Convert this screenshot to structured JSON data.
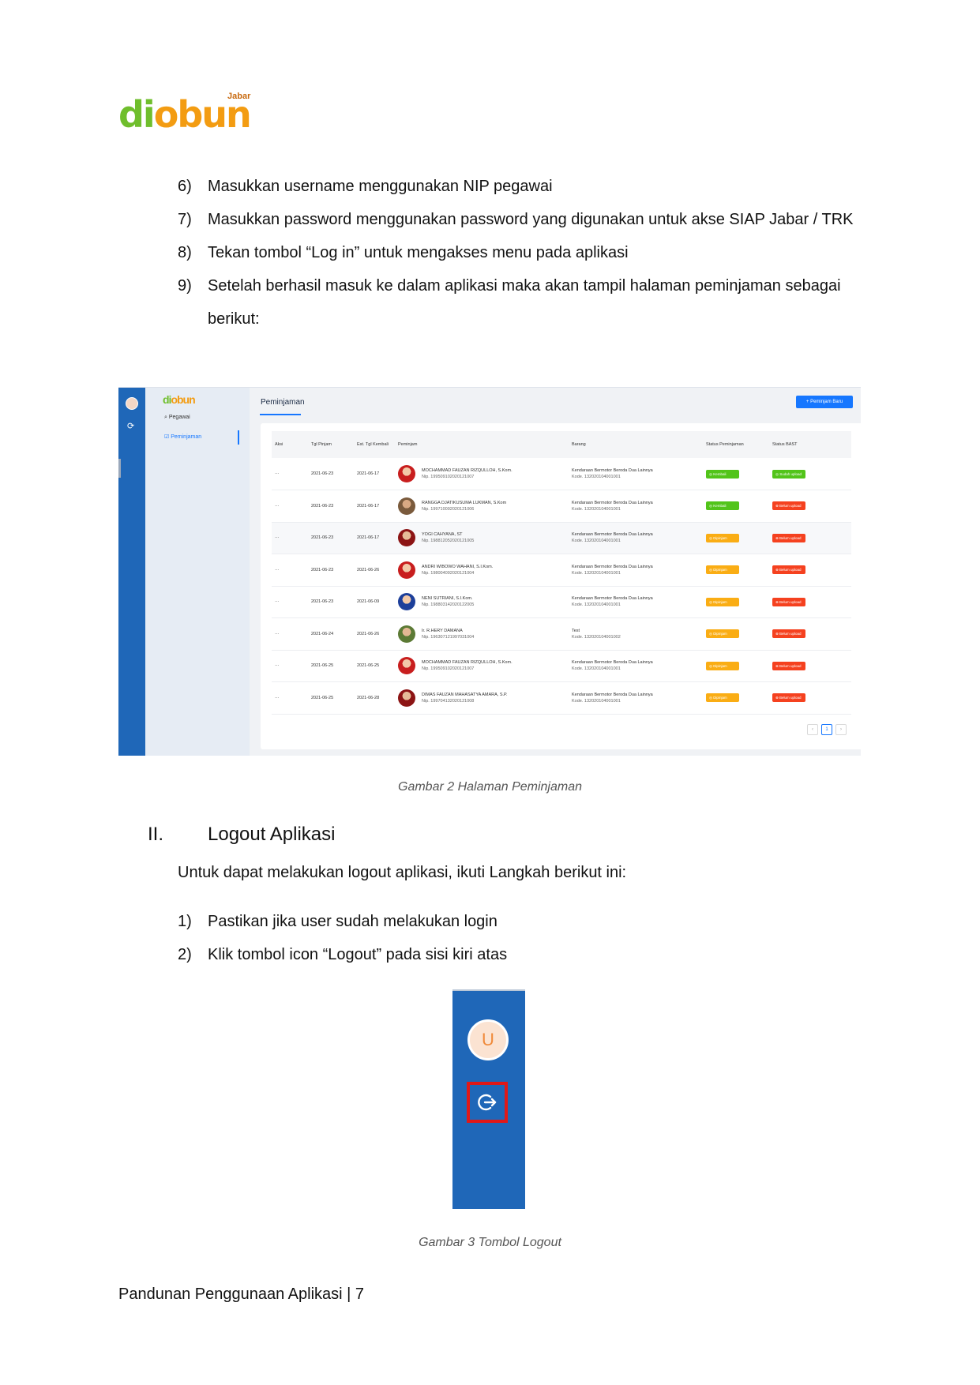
{
  "logo": {
    "brand": "diobun",
    "region": "Jabar"
  },
  "steps_1": [
    {
      "num": "6)",
      "text": "Masukkan username menggunakan NIP pegawai"
    },
    {
      "num": "7)",
      "text": "Masukkan password menggunakan password yang digunakan untuk akse SIAP Jabar / TRK"
    },
    {
      "num": "8)",
      "text": "Tekan tombol “Log in” untuk mengakses menu pada aplikasi"
    },
    {
      "num": "9)",
      "text": "Setelah berhasil masuk ke dalam aplikasi maka akan tampil halaman peminjaman sebagai berikut:"
    }
  ],
  "screenshot_1": {
    "logo": "diobun",
    "nav": [
      "Pegawai",
      "Peminjaman"
    ],
    "tab": "Peminjaman",
    "new_button": "+ Peminjam Baru",
    "columns": [
      "Aksi",
      "Tgl Pinjam",
      "Est. Tgl Kembali",
      "Peminjam",
      "Barang",
      "Status Peminjaman",
      "Status BAST"
    ],
    "rows": [
      {
        "aksi": "···",
        "tgl": "2021-06-23",
        "est": "2021-06-17",
        "name": "MOCHAMMAD FAUZAN RIZQULLOH, S.Kom.",
        "nip": "Nip. 199509102020121007",
        "item": "Kendaraan Bermotor Beroda Dua Lainnya",
        "kode": "Kode. 132020104001001",
        "status": "Kembali",
        "bast": "Sudah upload"
      },
      {
        "aksi": "···",
        "tgl": "2021-06-23",
        "est": "2021-06-17",
        "name": "RANGGA DJATIKUSUMA LUKMAN, S.Kom",
        "nip": "Nip. 199710092020121006",
        "item": "Kendaraan Bermotor Beroda Dua Lainnya",
        "kode": "Kode. 132020104001001",
        "status": "Kembali",
        "bast": "Belum upload"
      },
      {
        "aksi": "···",
        "tgl": "2021-06-23",
        "est": "2021-06-17",
        "name": "YOGI CAHYANA, ST",
        "nip": "Nip. 198812052020121005",
        "item": "Kendaraan Bermotor Beroda Dua Lainnya",
        "kode": "Kode. 132020104001001",
        "status": "Dipinjam",
        "bast": "Belum upload"
      },
      {
        "aksi": "···",
        "tgl": "2021-06-23",
        "est": "2021-06-26",
        "name": "ANDRI WIBOWO WAHANI, S.I.Kom.",
        "nip": "Nip. 198004092020121004",
        "item": "Kendaraan Bermotor Beroda Dua Lainnya",
        "kode": "Kode. 132020104001001",
        "status": "Dipinjam",
        "bast": "Belum upload"
      },
      {
        "aksi": "···",
        "tgl": "2021-06-23",
        "est": "2021-06-09",
        "name": "NENI SUTRIANI, S.I.Kom.",
        "nip": "Nip. 198803142020122005",
        "item": "Kendaraan Bermotor Beroda Dua Lainnya",
        "kode": "Kode. 132020104001001",
        "status": "Dipinjam",
        "bast": "Belum upload"
      },
      {
        "aksi": "···",
        "tgl": "2021-06-24",
        "est": "2021-06-26",
        "name": "Ir. R.HERY DAMANA",
        "nip": "Nip. 196307121997031004",
        "item": "Test",
        "kode": "Kode. 132020104001002",
        "status": "Dipinjam",
        "bast": "Belum upload"
      },
      {
        "aksi": "···",
        "tgl": "2021-06-25",
        "est": "2021-06-25",
        "name": "MOCHAMMAD FAUZAN RIZQULLOH, S.Kom.",
        "nip": "Nip. 199509102020121007",
        "item": "Kendaraan Bermotor Beroda Dua Lainnya",
        "kode": "Kode. 132020104001001",
        "status": "Dipinjam",
        "bast": "Belum upload"
      },
      {
        "aksi": "···",
        "tgl": "2021-06-25",
        "est": "2021-06-28",
        "name": "DIMAS FAUZAN MAHASATYA AMARA, S.P.",
        "nip": "Nip. 199704132020121008",
        "item": "Kendaraan Bermotor Beroda Dua Lainnya",
        "kode": "Kode. 132020104001001",
        "status": "Dipinjam",
        "bast": "Belum upload"
      }
    ],
    "pager": {
      "prev": "‹",
      "current": "1",
      "next": "›"
    }
  },
  "caption_1": "Gambar 2 Halaman Peminjaman",
  "section": {
    "roman": "II.",
    "title": "Logout Aplikasi"
  },
  "section_intro": "Untuk dapat melakukan logout aplikasi, ikuti Langkah berikut ini:",
  "steps_2": [
    {
      "num": "1)",
      "text": "Pastikan jika user sudah melakukan login"
    },
    {
      "num": "2)",
      "text": "Klik tombol icon “Logout” pada sisi kiri atas"
    }
  ],
  "screenshot_2": {
    "avatar_letter": "U"
  },
  "caption_2": "Gambar 3 Tombol Logout",
  "footer": "Pandunan Penggunaan Aplikasi | 7",
  "colors": {
    "sidebar_blue": "#1f67b8",
    "primary": "#1677ff",
    "success": "#52c41a",
    "warning": "#faad14",
    "danger": "#f5411f",
    "highlight": "#e01818"
  }
}
